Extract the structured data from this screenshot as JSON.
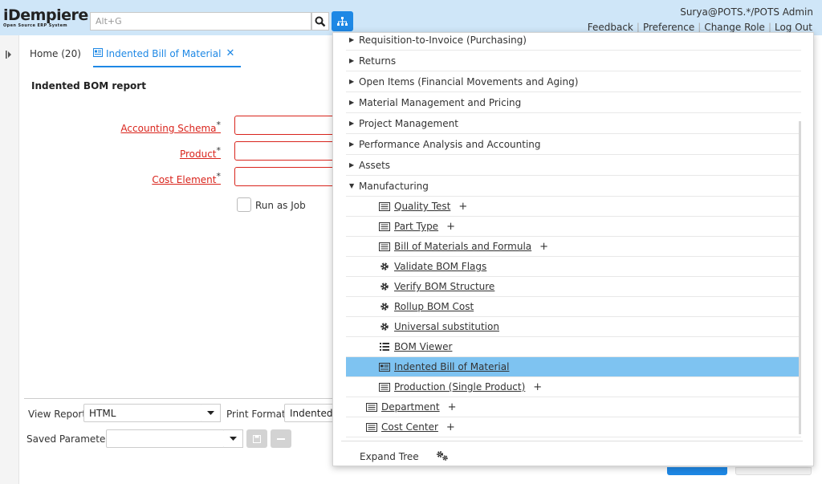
{
  "header": {
    "logo_main": "iDempiere",
    "logo_sub": "Open Source ERP System",
    "search_placeholder": "Alt+G",
    "user": "Surya@POTS.*/POTS Admin",
    "links": [
      "Feedback",
      "Preference",
      "Change Role",
      "Log Out"
    ]
  },
  "tabs": {
    "home": "Home (20)",
    "active": "Indented Bill of Material"
  },
  "form": {
    "title": "Indented BOM report",
    "fields": [
      {
        "label": "Accounting Schema"
      },
      {
        "label": "Product"
      },
      {
        "label": "Cost Element"
      }
    ],
    "run_as_job": "Run as Job"
  },
  "bottom": {
    "view_report_label": "View Report",
    "view_report_value": "HTML",
    "print_format_label": "Print Format",
    "print_format_value": "Indented B",
    "saved_params_label": "Saved Parameters"
  },
  "menu": {
    "categories": [
      "Requisition-to-Invoice (Purchasing)",
      "Returns",
      "Open Items (Financial Movements and Aging)",
      "Material Management and Pricing",
      "Project Management",
      "Performance Analysis and Accounting",
      "Assets",
      "Manufacturing"
    ],
    "manufacturing_items": [
      {
        "label": "Quality Test",
        "icon": "window-icon",
        "plus": true
      },
      {
        "label": "Part Type",
        "icon": "window-icon",
        "plus": true
      },
      {
        "label": "Bill of Materials and Formula",
        "icon": "window-icon",
        "plus": true
      },
      {
        "label": "Validate BOM Flags",
        "icon": "gear-icon",
        "plus": false
      },
      {
        "label": "Verify BOM Structure",
        "icon": "gear-icon",
        "plus": false
      },
      {
        "label": "Rollup BOM Cost",
        "icon": "gear-icon",
        "plus": false
      },
      {
        "label": "Universal substitution",
        "icon": "gear-icon",
        "plus": false
      },
      {
        "label": "BOM Viewer",
        "icon": "list-icon",
        "plus": false
      },
      {
        "label": "Indented Bill of Material",
        "icon": "report-icon",
        "plus": false,
        "selected": true
      },
      {
        "label": "Production (Single Product)",
        "icon": "window-icon",
        "plus": true
      }
    ],
    "other_items": [
      {
        "label": "Department",
        "icon": "window-icon",
        "plus": true
      },
      {
        "label": "Cost Center",
        "icon": "window-icon",
        "plus": true
      }
    ],
    "expand_tree": "Expand Tree",
    "plus_symbol": "+"
  },
  "colors": {
    "header_bg": "#cfe6f8",
    "accent": "#1e88e5",
    "mandatory": "#d9241c",
    "selected_row": "#7ec3f1"
  }
}
